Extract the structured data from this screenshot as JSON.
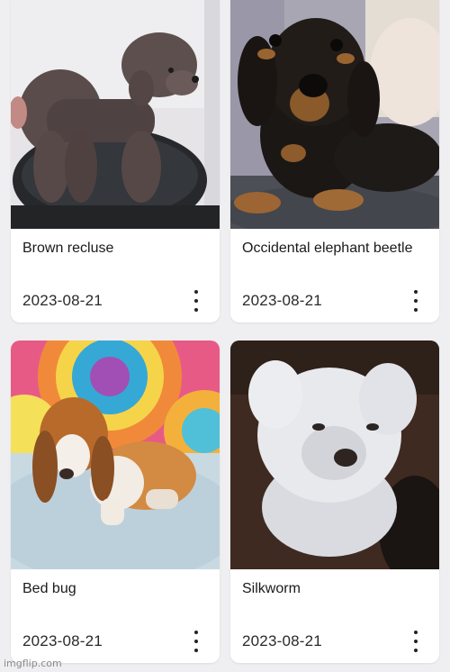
{
  "cards": [
    {
      "title": "Brown recluse",
      "date": "2023-08-21",
      "image": "brown-poodle-photo"
    },
    {
      "title": "Occidental elephant beetle",
      "date": "2023-08-21",
      "image": "dachshund-puppy-photo"
    },
    {
      "title": "Bed bug",
      "date": "2023-08-21",
      "image": "basset-hound-puppy-photo"
    },
    {
      "title": "Silkworm",
      "date": "2023-08-21",
      "image": "white-fluffy-dog-photo"
    }
  ],
  "watermark": "imgflip.com",
  "colors": {
    "background": "#efeff1",
    "card": "#ffffff",
    "text": "#1a1a1a"
  }
}
